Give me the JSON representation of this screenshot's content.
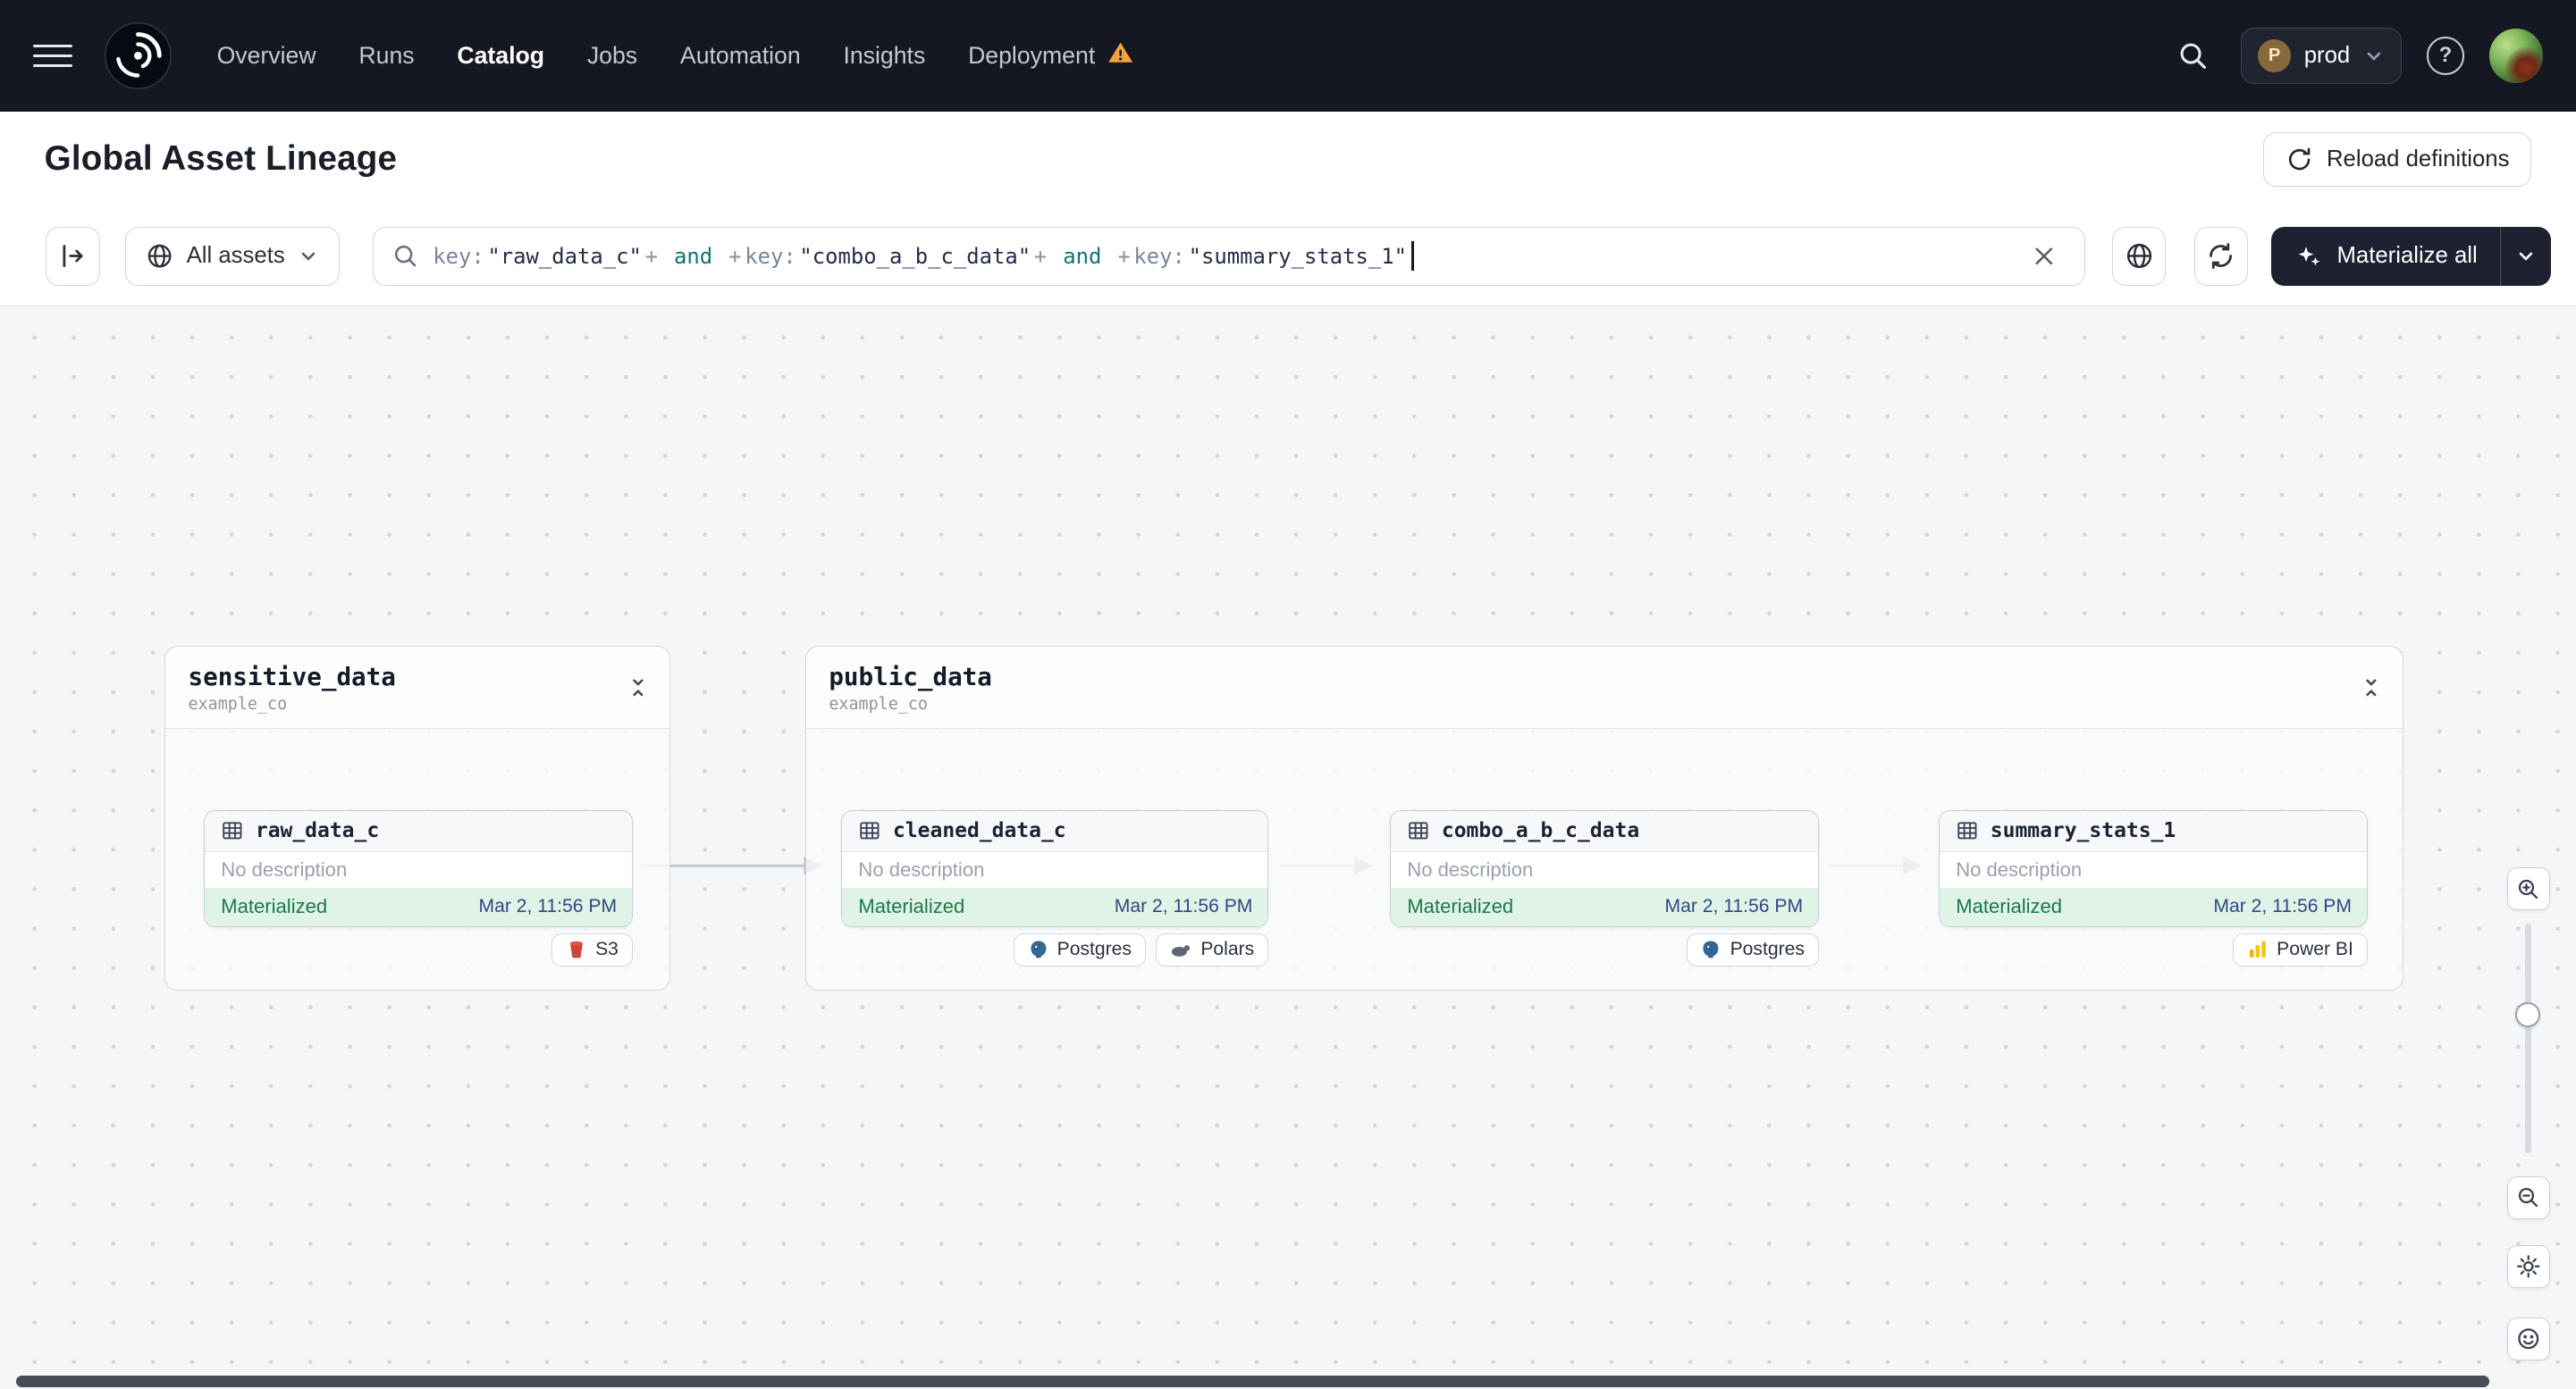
{
  "nav": {
    "menu_items": [
      {
        "label": "Overview"
      },
      {
        "label": "Runs"
      },
      {
        "label": "Catalog"
      },
      {
        "label": "Jobs"
      },
      {
        "label": "Automation"
      },
      {
        "label": "Insights"
      },
      {
        "label": "Deployment"
      }
    ],
    "active_item": "Catalog",
    "deployment_has_warning": true,
    "deployment_switcher": {
      "initial": "P",
      "label": "prod"
    },
    "help_glyph": "?"
  },
  "header": {
    "title": "Global Asset Lineage",
    "reload_button_label": "Reload definitions"
  },
  "toolbar": {
    "asset_filter_label": "All assets",
    "materialize_label": "Materialize all",
    "search": {
      "tokens": [
        {
          "text": "key:",
          "type": "key"
        },
        {
          "text": "\"raw_data_c\"",
          "type": "string"
        },
        {
          "text": "+",
          "type": "op"
        },
        {
          "text": " and ",
          "type": "keyword"
        },
        {
          "text": "+",
          "type": "op"
        },
        {
          "text": "key:",
          "type": "key"
        },
        {
          "text": "\"combo_a_b_c_data\"",
          "type": "string"
        },
        {
          "text": "+",
          "type": "op"
        },
        {
          "text": " and ",
          "type": "keyword"
        },
        {
          "text": "+",
          "type": "op"
        },
        {
          "text": "key:",
          "type": "key"
        },
        {
          "text": "\"summary_stats_1\"",
          "type": "string"
        }
      ]
    }
  },
  "canvas": {
    "groups": [
      {
        "name": "sensitive_data",
        "org": "example_co",
        "assets": [
          {
            "name": "raw_data_c",
            "description": "No description",
            "status": "Materialized",
            "materialized_at": "Mar 2, 11:56 PM",
            "tags": [
              {
                "label": "S3",
                "icon": "s3-icon"
              }
            ]
          }
        ]
      },
      {
        "name": "public_data",
        "org": "example_co",
        "assets": [
          {
            "name": "cleaned_data_c",
            "description": "No description",
            "status": "Materialized",
            "materialized_at": "Mar 2, 11:56 PM",
            "tags": [
              {
                "label": "Postgres",
                "icon": "postgres-icon"
              },
              {
                "label": "Polars",
                "icon": "polars-icon"
              }
            ]
          },
          {
            "name": "combo_a_b_c_data",
            "description": "No description",
            "status": "Materialized",
            "materialized_at": "Mar 2, 11:56 PM",
            "tags": [
              {
                "label": "Postgres",
                "icon": "postgres-icon"
              }
            ]
          },
          {
            "name": "summary_stats_1",
            "description": "No description",
            "status": "Materialized",
            "materialized_at": "Mar 2, 11:56 PM",
            "tags": [
              {
                "label": "Power BI",
                "icon": "powerbi-icon"
              }
            ]
          }
        ]
      }
    ],
    "edges": [
      {
        "from": "raw_data_c",
        "to": "cleaned_data_c"
      },
      {
        "from": "cleaned_data_c",
        "to": "combo_a_b_c_data"
      },
      {
        "from": "combo_a_b_c_data",
        "to": "summary_stats_1"
      }
    ]
  },
  "colors": {
    "nav_bg": "#151822",
    "materialize_bg": "#1d2130",
    "status_green_bg": "#dff3e7",
    "status_green_text": "#1a7a4a",
    "timestamp_blue": "#2c4a85",
    "warning_orange": "#f2a33c",
    "canvas_bg": "#f5f6f8"
  }
}
